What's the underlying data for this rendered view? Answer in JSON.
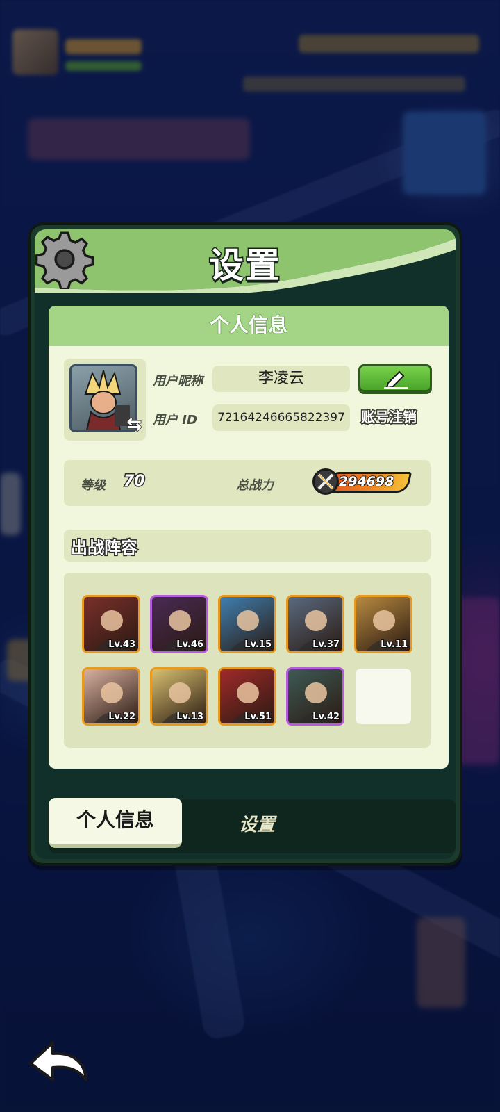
{
  "dialog": {
    "title": "设置",
    "panel_header": "个人信息"
  },
  "profile": {
    "nickname_label": "用户昵称",
    "nickname": "李凌云",
    "id_label": "用户 ID",
    "user_id": "72164246665822397",
    "logout_label": "账号注销"
  },
  "stats": {
    "level_label": "等级",
    "level": "70",
    "power_label": "总战力",
    "power": "294698"
  },
  "team": {
    "title": "出战阵容",
    "heroes": [
      {
        "level": "Lv.43",
        "rarity": "orange",
        "color": "#7a2f2a"
      },
      {
        "level": "Lv.46",
        "rarity": "purple",
        "color": "#4a2a55"
      },
      {
        "level": "Lv.15",
        "rarity": "orange",
        "color": "#3f7fb0"
      },
      {
        "level": "Lv.37",
        "rarity": "orange",
        "color": "#5a6a80"
      },
      {
        "level": "Lv.11",
        "rarity": "orange",
        "color": "#b88a40"
      },
      {
        "level": "Lv.22",
        "rarity": "orange",
        "color": "#d8b0a0"
      },
      {
        "level": "Lv.13",
        "rarity": "orange",
        "color": "#d8c070"
      },
      {
        "level": "Lv.51",
        "rarity": "orange",
        "color": "#a02a2a"
      },
      {
        "level": "Lv.42",
        "rarity": "purple",
        "color": "#3e5a55"
      }
    ]
  },
  "tabs": {
    "profile": "个人信息",
    "settings": "设置"
  },
  "icons": {
    "gear": "gear-icon",
    "edit": "pencil-icon",
    "back": "back-arrow-icon",
    "power": "crossed-swords-icon"
  }
}
